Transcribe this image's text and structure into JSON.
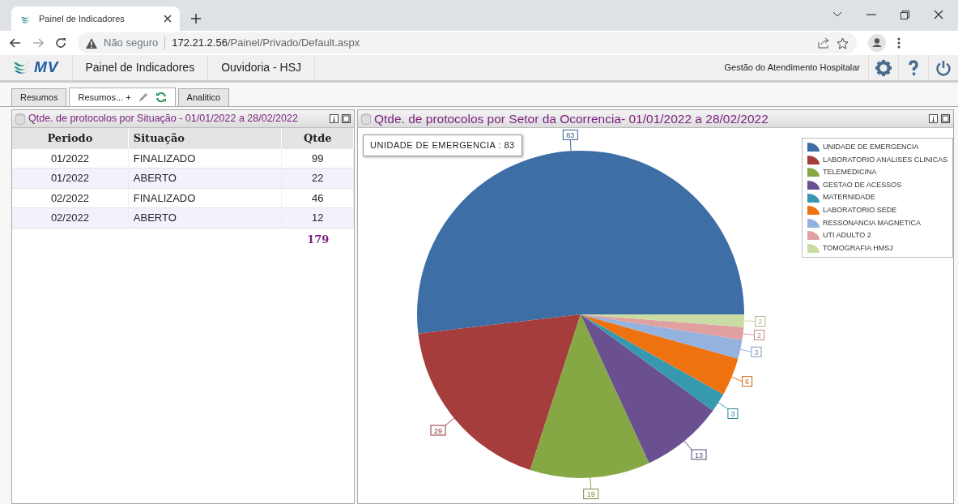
{
  "browser": {
    "tab_title": "Painel de Indicadores",
    "security": "Não seguro",
    "url_host": "172.21.2.56",
    "url_path": "/Painel/Privado/Default.aspx"
  },
  "app_header": {
    "logo_text": "MV",
    "title": "Painel de Indicadores",
    "subtitle": "Ouvidoria - HSJ",
    "system": "Gestão do Atendimento Hospitalar"
  },
  "tabs": [
    {
      "label": "Resumos",
      "selected": false,
      "editable": false
    },
    {
      "label": "Resumos... +",
      "selected": true,
      "editable": true
    },
    {
      "label": "Analitico",
      "selected": false,
      "editable": false
    }
  ],
  "left_panel": {
    "title": "Qtde. de protocolos por Situação - 01/01/2022 a 28/02/2022",
    "table": {
      "columns": [
        "Periodo",
        "Situação",
        "Qtde"
      ],
      "rows": [
        {
          "cells": [
            "01/2022",
            "FINALIZADO",
            "99"
          ]
        },
        {
          "cells": [
            "01/2022",
            "ABERTO",
            "22"
          ]
        },
        {
          "cells": [
            "02/2022",
            "FINALIZADO",
            "46"
          ]
        },
        {
          "cells": [
            "02/2022",
            "ABERTO",
            "12"
          ]
        }
      ],
      "total": "179"
    }
  },
  "right_panel": {
    "title": "Qtde. de protocolos por Setor da Ocorrencia- 01/01/2022 a 28/02/2022",
    "tooltip": "UNIDADE DE EMERGENCIA : 83",
    "chart_data": {
      "type": "pie",
      "data_labels": true,
      "legend": "top-right",
      "categories": [
        "UNIDADE DE EMERGENCIA",
        "LABORATORIO ANALISES CLINICAS",
        "TELEMEDICINA",
        "GESTAO DE ACESSOS",
        "MATERNIDADE",
        "LABORATORIO SEDE",
        "RESSONANCIA MAGNETICA",
        "UTI ADULTO 2",
        "TOMOGRAFIA HMSJ"
      ],
      "values": [
        83,
        29,
        19,
        13,
        3,
        6,
        3,
        2,
        2
      ],
      "colors": [
        "#3e6ea6",
        "#a63d3d",
        "#86a844",
        "#6a5090",
        "#3799b0",
        "#ef7210",
        "#93b3de",
        "#e0a0a0",
        "#c8dca4"
      ]
    }
  }
}
